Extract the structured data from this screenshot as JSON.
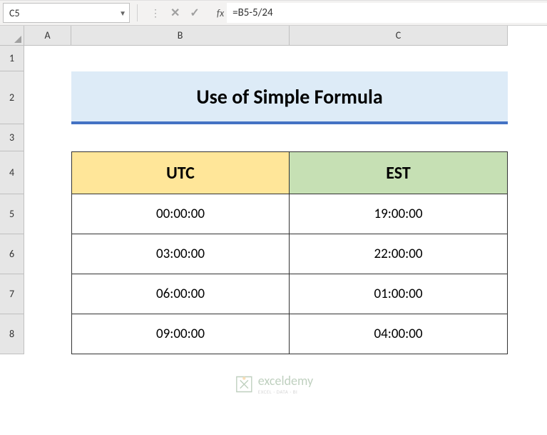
{
  "formula_bar": {
    "cell_reference": "C5",
    "formula": "=B5-5/24",
    "fx_label": "fx"
  },
  "columns": {
    "a": "A",
    "b": "B",
    "c": "C"
  },
  "rows": {
    "r1": "1",
    "r2": "2",
    "r3": "3",
    "r4": "4",
    "r5": "5",
    "r6": "6",
    "r7": "7",
    "r8": "8"
  },
  "sheet": {
    "title": "Use of Simple Formula",
    "headers": {
      "utc": "UTC",
      "est": "EST"
    },
    "data": [
      {
        "utc": "00:00:00",
        "est": "19:00:00"
      },
      {
        "utc": "03:00:00",
        "est": "22:00:00"
      },
      {
        "utc": "06:00:00",
        "est": "01:00:00"
      },
      {
        "utc": "09:00:00",
        "est": "04:00:00"
      }
    ]
  },
  "watermark": {
    "brand": "exceldemy",
    "subtitle": "EXCEL · DATA · BI"
  }
}
